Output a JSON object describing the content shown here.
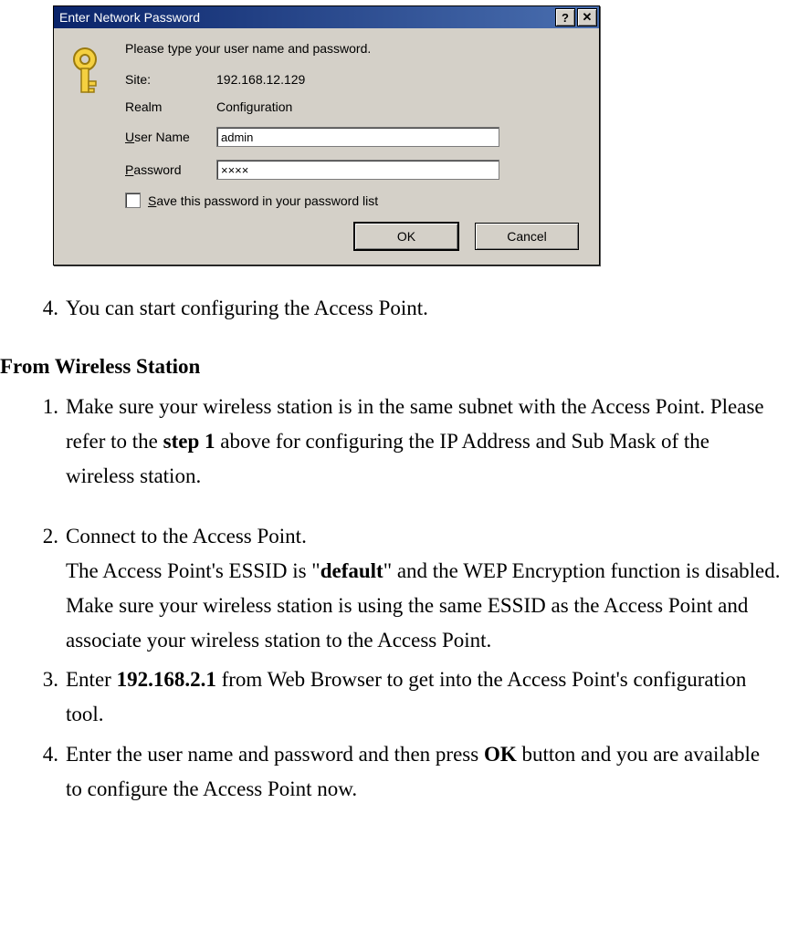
{
  "dialog": {
    "title": "Enter Network Password",
    "help_glyph": "?",
    "close_glyph": "✕",
    "prompt": "Please type your user name and password.",
    "site_label": "Site:",
    "site_value": "192.168.12.129",
    "realm_label": "Realm",
    "realm_value": "Configuration",
    "user_u": "U",
    "user_rest": "ser Name",
    "user_value": "admin",
    "pass_u": "P",
    "pass_rest": "assword",
    "pass_value": "××××",
    "save_u": "S",
    "save_rest": "ave this password in your password list",
    "ok_label": "OK",
    "cancel_label": "Cancel"
  },
  "doc": {
    "step4_num": "4.",
    "step4_text": "You can start configuring the Access Point.",
    "heading": "From Wireless Station",
    "ws1_num": "1.",
    "ws1_a": "Make sure your wireless station is in the same subnet with the Access Point. Please refer to the ",
    "ws1_b": "step 1",
    "ws1_c": " above for configuring the IP Address and Sub Mask of the wireless station.",
    "ws2_num": "2.",
    "ws2_a": "Connect to the Access Point.",
    "ws2_b1": "The Access Point's ESSID is \"",
    "ws2_b2": "default",
    "ws2_b3": "\" and the WEP Encryption function is disabled. Make sure your wireless station is using the same ESSID as the Access Point and associate your wireless station to the Access Point.",
    "ws3_num": "3.",
    "ws3_a": "Enter ",
    "ws3_b": "192.168.2.1",
    "ws3_c": " from Web Browser to get into the Access Point's configuration tool.",
    "ws4_num": "4.",
    "ws4_a": "Enter the user name and password and then press ",
    "ws4_b": "OK",
    "ws4_c": " button and you are available to configure the Access Point now."
  }
}
